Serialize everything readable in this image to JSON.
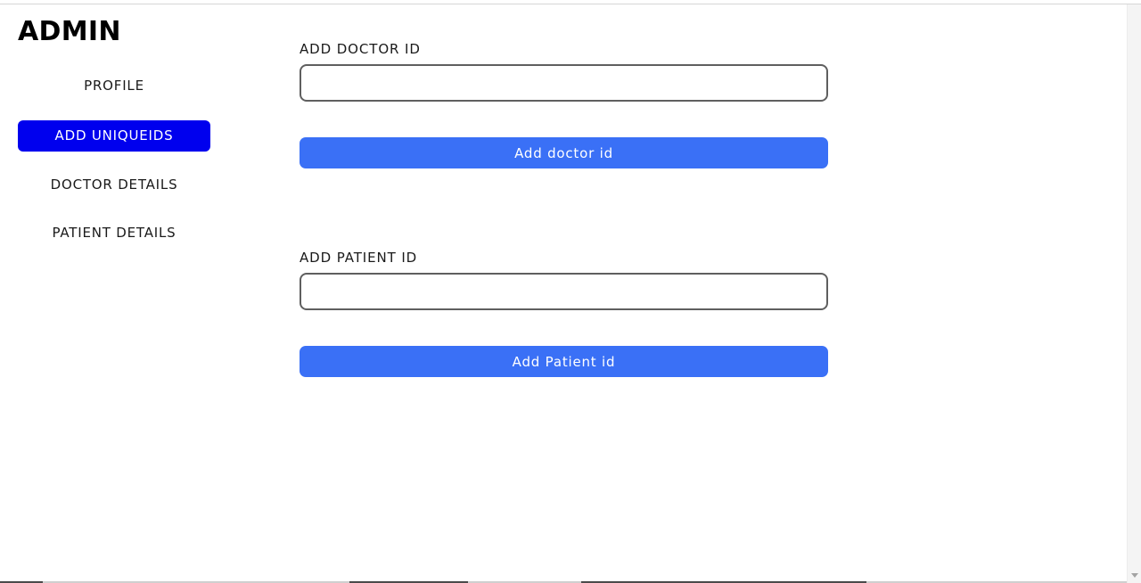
{
  "sidebar": {
    "brand": "ADMIN",
    "items": [
      {
        "label": "PROFILE",
        "active": false
      },
      {
        "label": "ADD UNIQUEIDS",
        "active": true
      },
      {
        "label": "DOCTOR DETAILS",
        "active": false
      },
      {
        "label": "PATIENT DETAILS",
        "active": false
      }
    ]
  },
  "main": {
    "doctor": {
      "label": "ADD DOCTOR ID",
      "value": "",
      "placeholder": "",
      "button_label": "Add doctor id"
    },
    "patient": {
      "label": "ADD PATIENT ID",
      "value": "",
      "placeholder": "",
      "button_label": "Add Patient id"
    }
  },
  "colors": {
    "active_nav_bg": "#0000ee",
    "button_bg": "#3a70f6",
    "input_border": "#5f5f5f"
  },
  "icons": {
    "scroll_down": "scroll-down-arrow-icon"
  }
}
